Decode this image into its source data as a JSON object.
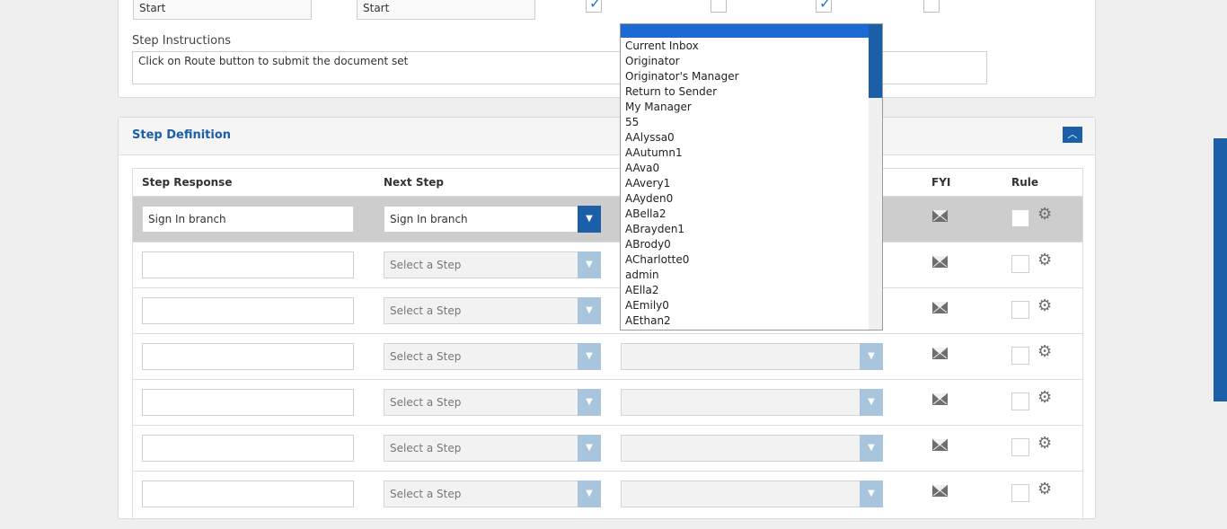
{
  "top_card": {
    "field1_value": "Start",
    "field2_value": "Start",
    "step_instructions_label": "Step Instructions",
    "step_instructions_value": "Click on Route button to submit the document set"
  },
  "step_definition": {
    "title": "Step Definition",
    "headers": {
      "step_response": "Step Response",
      "next_step": "Next Step",
      "fyi": "FYI",
      "rule": "Rule"
    },
    "rows": [
      {
        "response": "Sign In branch",
        "next_step": "Sign In branch"
      },
      {
        "response": "",
        "next_step": "Select a Step"
      },
      {
        "response": "",
        "next_step": "Select a Step"
      },
      {
        "response": "",
        "next_step": "Select a Step"
      },
      {
        "response": "",
        "next_step": "Select a Step"
      },
      {
        "response": "",
        "next_step": "Select a Step"
      },
      {
        "response": "",
        "next_step": "Select a Step"
      }
    ]
  },
  "dropdown_list": {
    "items": [
      "Current Inbox",
      "Originator",
      "Originator's Manager",
      "Return to Sender",
      "My Manager",
      "55",
      "AAlyssa0",
      "AAutumn1",
      "AAva0",
      "AAvery1",
      "AAyden0",
      "ABella2",
      "ABrayden1",
      "ABrody0",
      "ACharlotte0",
      "admin",
      "AElla2",
      "AEmily0",
      "AEthan2"
    ]
  },
  "colors": {
    "accent": "#1a5fa8",
    "accent_light": "#a9c4dd",
    "selection": "#1e6ad4"
  }
}
